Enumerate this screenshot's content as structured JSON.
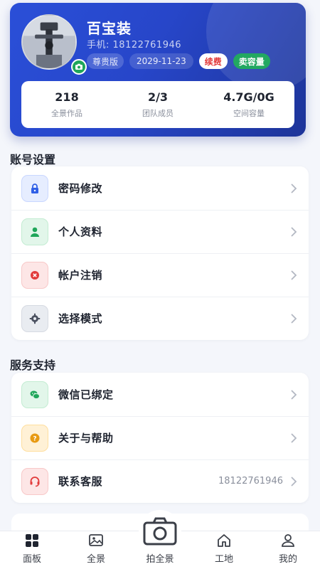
{
  "profile": {
    "name": "百宝装",
    "phone_label": "手机:",
    "phone": "18122761946",
    "level": "尊贵版",
    "expire_date": "2029-11-23",
    "renew_label": "续费",
    "sell_label": "卖容量",
    "stats": [
      {
        "value": "218",
        "label": "全景作品"
      },
      {
        "value": "2/3",
        "label": "团队成员"
      },
      {
        "value": "4.7G/0G",
        "label": "空间容量"
      }
    ]
  },
  "account_section": {
    "title": "账号设置",
    "items": [
      {
        "label": "密码修改",
        "icon": "lock-icon"
      },
      {
        "label": "个人资料",
        "icon": "user-icon"
      },
      {
        "label": "帐户注销",
        "icon": "cancel-icon"
      },
      {
        "label": "选择模式",
        "icon": "gear-icon"
      }
    ]
  },
  "service_section": {
    "title": "服务支持",
    "items": [
      {
        "label": "微信已绑定",
        "icon": "wechat-icon",
        "extra": ""
      },
      {
        "label": "关于与帮助",
        "icon": "help-icon",
        "extra": ""
      },
      {
        "label": "联系客服",
        "icon": "headset-icon",
        "extra": "18122761946"
      }
    ]
  },
  "tabbar": {
    "items": [
      {
        "label": "面板",
        "icon": "grid-icon"
      },
      {
        "label": "全景",
        "icon": "image-icon"
      },
      {
        "label": "拍全景",
        "icon": "camera-icon"
      },
      {
        "label": "工地",
        "icon": "home-icon"
      },
      {
        "label": "我的",
        "icon": "user-icon"
      }
    ]
  },
  "colors": {
    "brand_blue": "#2a4fd8",
    "renew_red": "#e23b3b",
    "sell_green": "#22a861"
  }
}
